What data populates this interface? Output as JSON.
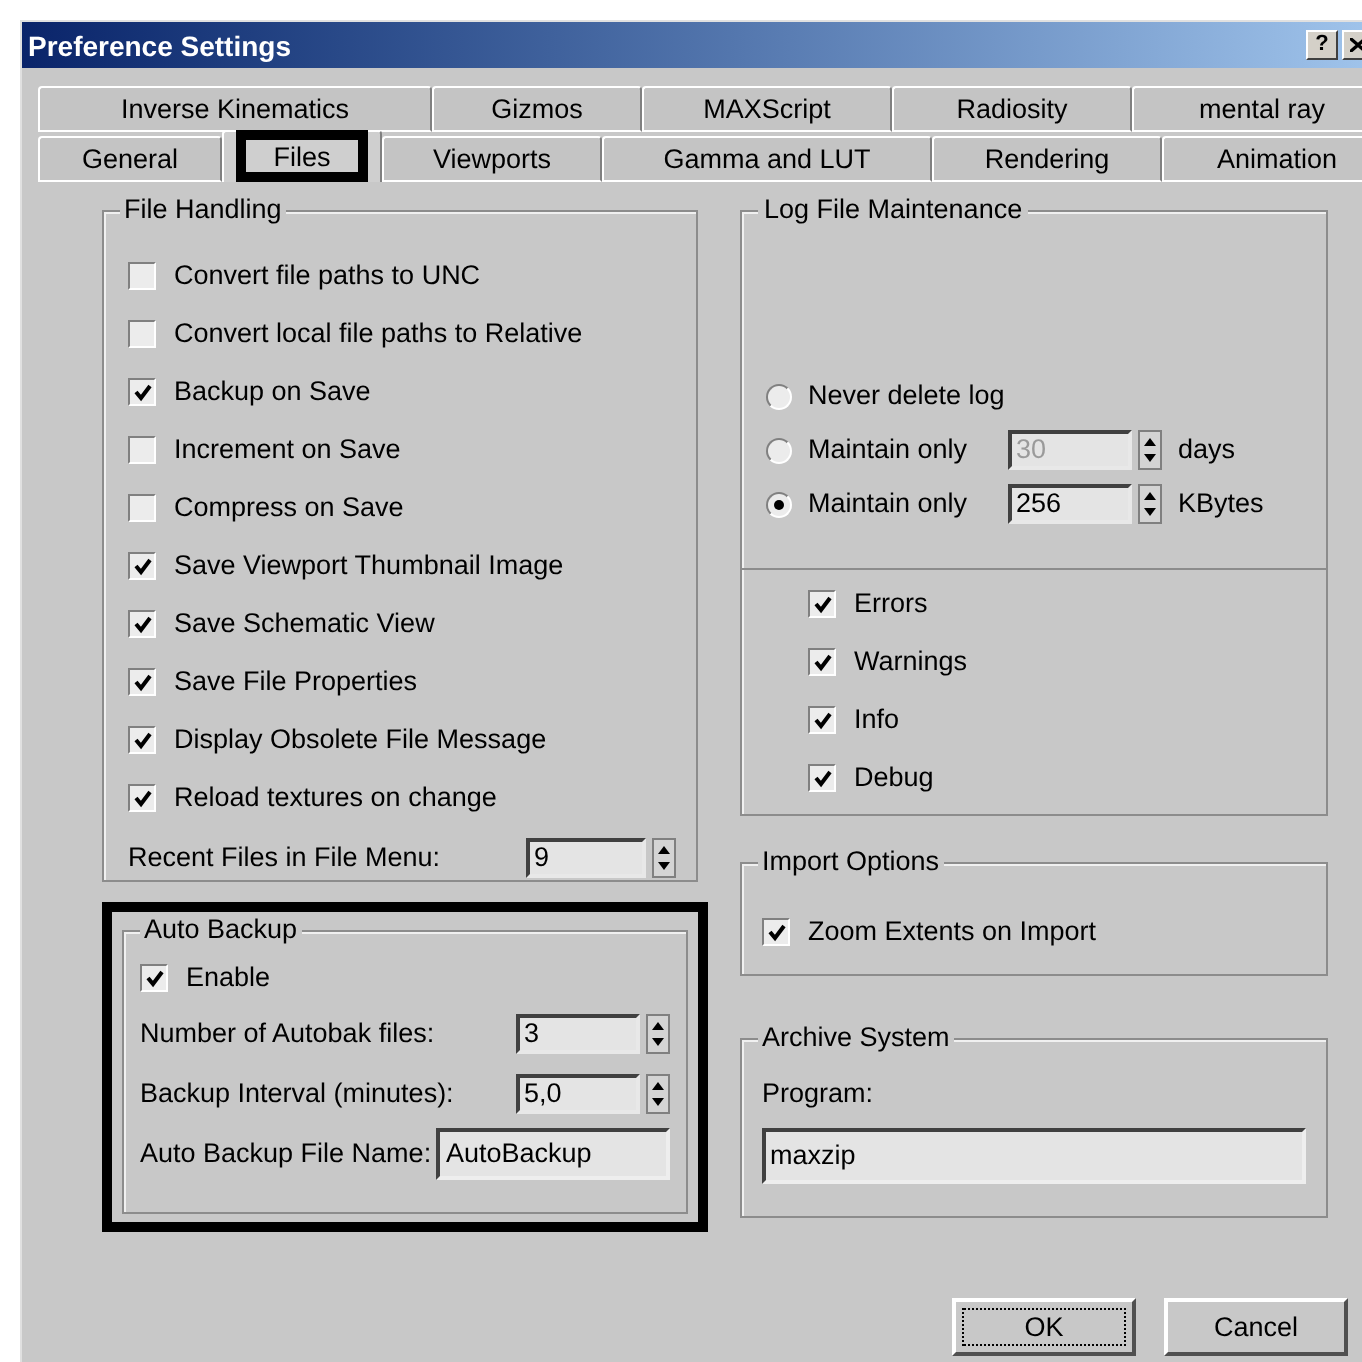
{
  "window": {
    "title": "Preference Settings",
    "help_button": "?"
  },
  "tab_rows": [
    [
      {
        "label": "Inverse Kinematics",
        "selected": false,
        "highlighted": false
      },
      {
        "label": "Gizmos",
        "selected": false,
        "highlighted": false
      },
      {
        "label": "MAXScript",
        "selected": false,
        "highlighted": false
      },
      {
        "label": "Radiosity",
        "selected": false,
        "highlighted": false
      },
      {
        "label": "mental ray",
        "selected": false,
        "highlighted": false
      }
    ],
    [
      {
        "label": "General",
        "selected": false,
        "highlighted": false
      },
      {
        "label": "Files",
        "selected": true,
        "highlighted": true
      },
      {
        "label": "Viewports",
        "selected": false,
        "highlighted": false
      },
      {
        "label": "Gamma and LUT",
        "selected": false,
        "highlighted": false
      },
      {
        "label": "Rendering",
        "selected": false,
        "highlighted": false
      },
      {
        "label": "Animation",
        "selected": false,
        "highlighted": false
      }
    ]
  ],
  "file_handling": {
    "title": "File Handling",
    "options": [
      {
        "label": "Convert file paths to UNC",
        "checked": false
      },
      {
        "label": "Convert local file paths to Relative",
        "checked": false
      },
      {
        "label": "Backup on Save",
        "checked": true
      },
      {
        "label": "Increment on Save",
        "checked": false
      },
      {
        "label": "Compress on Save",
        "checked": false
      },
      {
        "label": "Save Viewport Thumbnail Image",
        "checked": true
      },
      {
        "label": "Save Schematic View",
        "checked": true
      },
      {
        "label": "Save File Properties",
        "checked": true
      },
      {
        "label": "Display Obsolete File Message",
        "checked": true
      },
      {
        "label": "Reload textures on change",
        "checked": true
      }
    ],
    "recent_files": {
      "label": "Recent Files in File Menu:",
      "value": "9"
    }
  },
  "auto_backup": {
    "title": "Auto Backup",
    "highlighted": true,
    "enable": {
      "label": "Enable",
      "checked": true
    },
    "fields": [
      {
        "kind": "spinner",
        "label": "Number of Autobak files:",
        "value": "3"
      },
      {
        "kind": "spinner",
        "label": "Backup Interval (minutes):",
        "value": "5,0"
      },
      {
        "kind": "text",
        "label": "Auto Backup File Name:",
        "value": "AutoBackup"
      }
    ]
  },
  "log_file": {
    "title": "Log File Maintenance",
    "options": [
      {
        "kind": "plain",
        "label": "Never delete log",
        "selected": false
      },
      {
        "kind": "spinner",
        "label": "Maintain only",
        "value": "30",
        "unit": "days",
        "selected": false,
        "disabled": true
      },
      {
        "kind": "spinner",
        "label": "Maintain only",
        "value": "256",
        "unit": "KBytes",
        "selected": true,
        "disabled": false
      }
    ],
    "levels": [
      {
        "label": "Errors",
        "checked": true
      },
      {
        "label": "Warnings",
        "checked": true
      },
      {
        "label": "Info",
        "checked": true
      },
      {
        "label": "Debug",
        "checked": true
      }
    ]
  },
  "import_options": {
    "title": "Import Options",
    "options": [
      {
        "label": "Zoom Extents on Import",
        "checked": true
      }
    ]
  },
  "archive_system": {
    "title": "Archive System",
    "label": "Program:",
    "value": "maxzip"
  },
  "buttons": [
    {
      "label": "OK",
      "default": true
    },
    {
      "label": "Cancel",
      "default": false
    }
  ]
}
